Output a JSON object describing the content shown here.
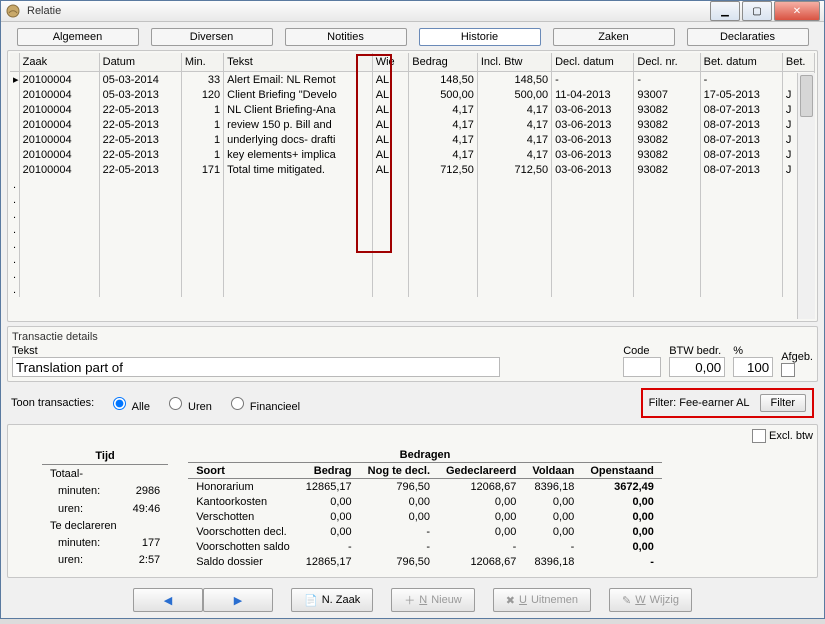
{
  "window": {
    "title": "Relatie"
  },
  "tabs": [
    "Algemeen",
    "Diversen",
    "Notities",
    "Historie",
    "Zaken",
    "Declaraties"
  ],
  "active_tab": 3,
  "columns": [
    "Zaak",
    "Datum",
    "Min.",
    "Tekst",
    "Wie",
    "Bedrag",
    "Incl. Btw",
    "Decl. datum",
    "Decl. nr.",
    "Bet. datum",
    "Bet."
  ],
  "rows": [
    {
      "zaak": "20100004",
      "datum": "05-03-2014",
      "min": "33",
      "tekst": "Alert Email: NL Remot",
      "wie": "AL",
      "bedrag": "148,50",
      "incl": "148,50",
      "ddatum": "-",
      "dnr": "-",
      "bdatum": "-",
      "bet": ""
    },
    {
      "zaak": "20100004",
      "datum": "05-03-2013",
      "min": "120",
      "tekst": "Client Briefing \"Develo",
      "wie": "AL",
      "bedrag": "500,00",
      "incl": "500,00",
      "ddatum": "11-04-2013",
      "dnr": "93007",
      "bdatum": "17-05-2013",
      "bet": "J"
    },
    {
      "zaak": "20100004",
      "datum": "22-05-2013",
      "min": "1",
      "tekst": "NL Client Briefing-Ana",
      "wie": "AL",
      "bedrag": "4,17",
      "incl": "4,17",
      "ddatum": "03-06-2013",
      "dnr": "93082",
      "bdatum": "08-07-2013",
      "bet": "J"
    },
    {
      "zaak": "20100004",
      "datum": "22-05-2013",
      "min": "1",
      "tekst": "review 150 p. Bill and",
      "wie": "AL",
      "bedrag": "4,17",
      "incl": "4,17",
      "ddatum": "03-06-2013",
      "dnr": "93082",
      "bdatum": "08-07-2013",
      "bet": "J"
    },
    {
      "zaak": "20100004",
      "datum": "22-05-2013",
      "min": "1",
      "tekst": "underlying docs- drafti",
      "wie": "AL",
      "bedrag": "4,17",
      "incl": "4,17",
      "ddatum": "03-06-2013",
      "dnr": "93082",
      "bdatum": "08-07-2013",
      "bet": "J"
    },
    {
      "zaak": "20100004",
      "datum": "22-05-2013",
      "min": "1",
      "tekst": "key elements+ implica",
      "wie": "AL",
      "bedrag": "4,17",
      "incl": "4,17",
      "ddatum": "03-06-2013",
      "dnr": "93082",
      "bdatum": "08-07-2013",
      "bet": "J"
    },
    {
      "zaak": "20100004",
      "datum": "22-05-2013",
      "min": "171",
      "tekst": "Total time mitigated.",
      "wie": "AL",
      "bedrag": "712,50",
      "incl": "712,50",
      "ddatum": "03-06-2013",
      "dnr": "93082",
      "bdatum": "08-07-2013",
      "bet": "J"
    }
  ],
  "details": {
    "title": "Transactie details",
    "tekst_label": "Tekst",
    "tekst_value": "Translation part of",
    "code": "Code",
    "btw": "BTW bedr.",
    "pct": "%",
    "afgeb": "Afgeb.",
    "btw_val": "0,00",
    "pct_val": "100"
  },
  "toon": {
    "label": "Toon transacties:",
    "alle": "Alle",
    "uren": "Uren",
    "fin": "Financieel"
  },
  "filter": {
    "label": "Filter: Fee-earner AL",
    "btn": "Filter"
  },
  "excl": "Excl. btw",
  "tijd": {
    "title": "Tijd",
    "totaal": "Totaal-",
    "minuten": "minuten:",
    "uren": "uren:",
    "te": "Te declareren",
    "tm": "2986",
    "tu": "49:46",
    "dm": "177",
    "du": "2:57"
  },
  "bedragen": {
    "title": "Bedragen",
    "cols": [
      "Soort",
      "Bedrag",
      "Nog te decl.",
      "Gedeclareerd",
      "Voldaan",
      "Openstaand"
    ],
    "rows": [
      [
        "Honorarium",
        "12865,17",
        "796,50",
        "12068,67",
        "8396,18",
        "3672,49"
      ],
      [
        "Kantoorkosten",
        "0,00",
        "0,00",
        "0,00",
        "0,00",
        "0,00"
      ],
      [
        "Verschotten",
        "0,00",
        "0,00",
        "0,00",
        "0,00",
        "0,00"
      ],
      [
        "Voorschotten decl.",
        "0,00",
        "-",
        "0,00",
        "0,00",
        "0,00"
      ],
      [
        "Voorschotten saldo",
        "-",
        "-",
        "-",
        "-",
        "0,00"
      ],
      [
        "Saldo dossier",
        "12865,17",
        "796,50",
        "12068,67",
        "8396,18",
        "-"
      ]
    ]
  },
  "toolbar": {
    "nzaak": "N. Zaak",
    "nieuw": "Nieuw",
    "uitnemen": "Uitnemen",
    "wijzig": "Wijzig"
  }
}
